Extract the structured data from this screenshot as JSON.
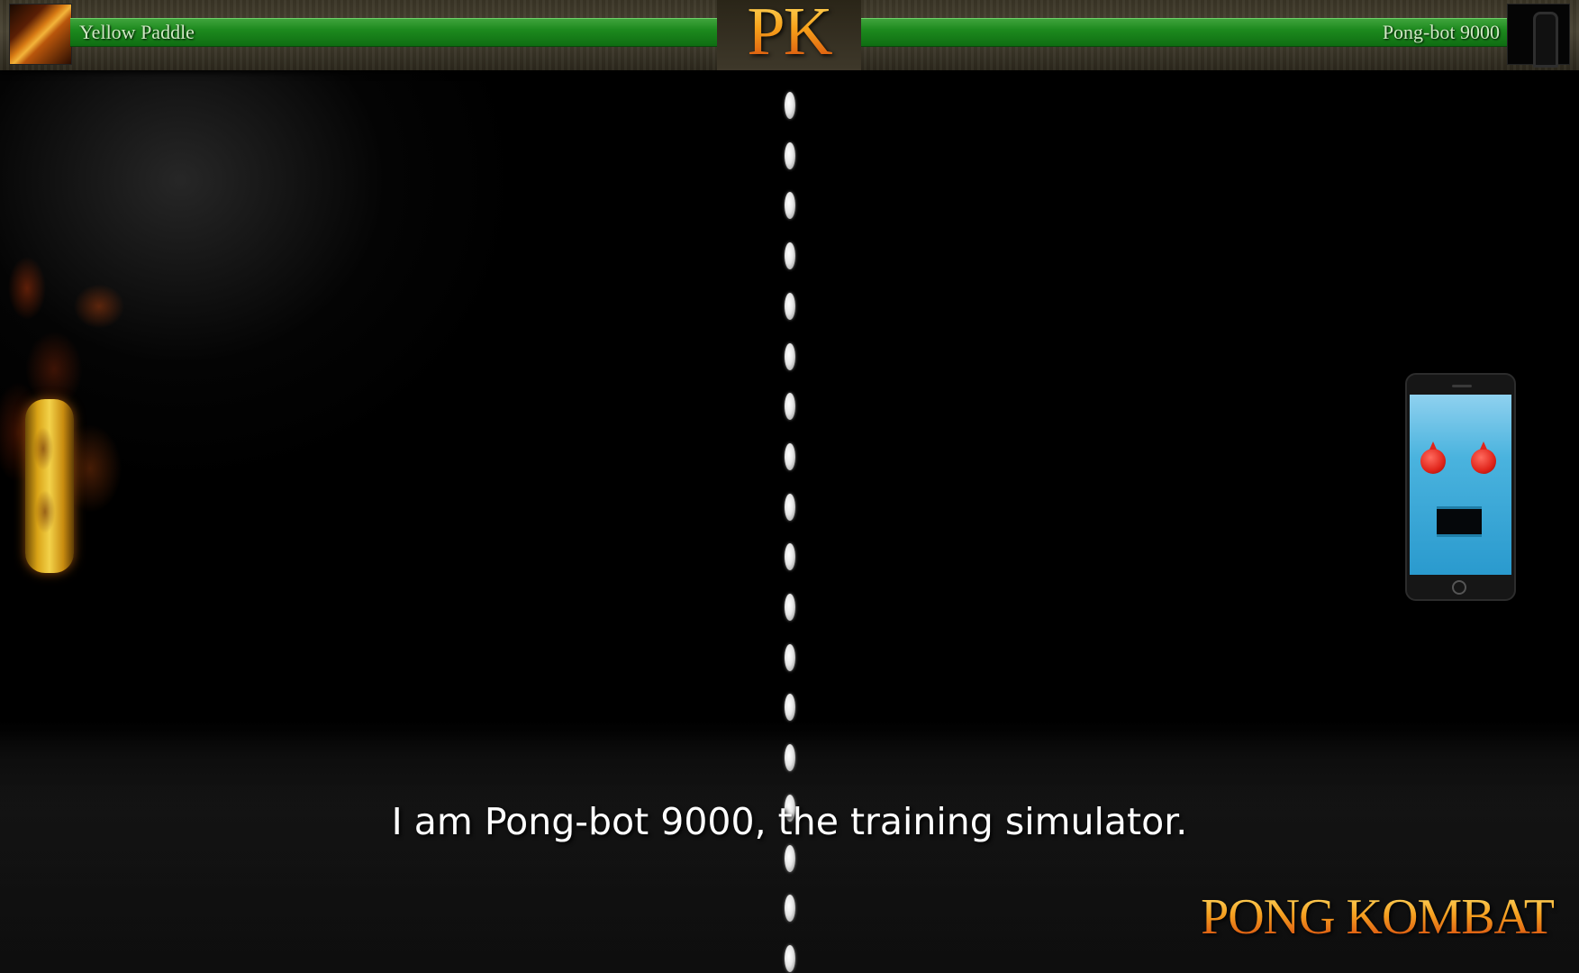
{
  "hud": {
    "player1": {
      "name": "Yellow Paddle",
      "health": 1.0,
      "portrait_icon": "flaming-paddle-icon"
    },
    "player2": {
      "name": "Pong-bot 9000",
      "health": 1.0,
      "portrait_icon": "robot-silhouette-icon"
    },
    "logo_text": "PK"
  },
  "dialogue": {
    "subtitle": "I am Pong-bot 9000, the training simulator."
  },
  "branding": {
    "game_title": "PONG KOMBAT"
  },
  "colors": {
    "health_bar": "#1d8a1e",
    "logo_gold": "#f5a020",
    "logo_red": "#d2400b",
    "bot_screen": "#4ab3de",
    "bot_eyes": "#e0241a"
  },
  "arena": {
    "net_segments": 18
  }
}
